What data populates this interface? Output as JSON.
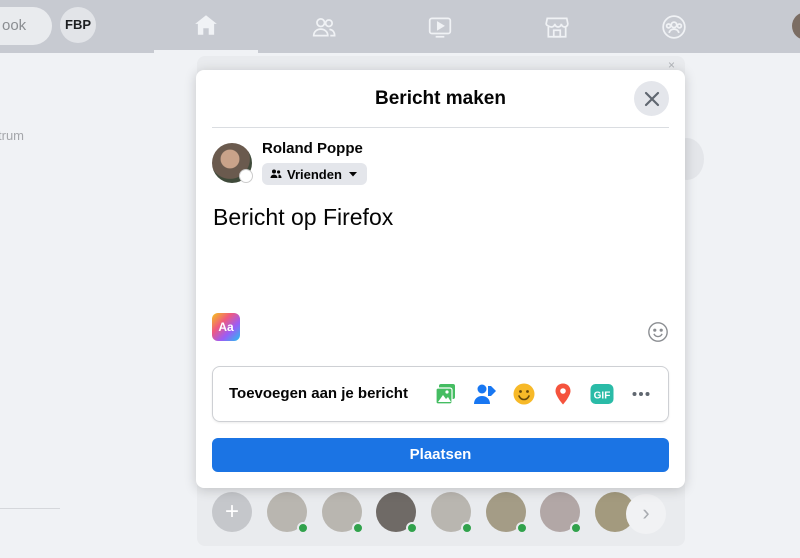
{
  "topbar": {
    "search_placeholder": "ook",
    "shortcut_label": "FBP"
  },
  "background": {
    "left_text": "trum",
    "close_glyph": "×",
    "next_glyph": "›",
    "add_story_glyph": "+"
  },
  "modal": {
    "title": "Bericht maken",
    "author_name": "Roland Poppe",
    "audience_label": "Vrienden",
    "post_text": "Bericht op Firefox",
    "text_format_label": "Aa",
    "add_to_post_label": "Toevoegen aan je bericht",
    "gif_label": "GIF",
    "more_label": "•••",
    "submit_label": "Plaatsen"
  },
  "colors": {
    "primary": "#1b74e4",
    "photo": "#45bd62",
    "tag": "#1877f2",
    "feeling": "#f7b928",
    "location": "#f5533d",
    "gif": "#2abba7"
  },
  "icons": [
    "home-icon",
    "friends-icon",
    "watch-icon",
    "marketplace-icon",
    "groups-icon",
    "close-icon",
    "friends-audience-icon",
    "caret-down-icon",
    "emoji-icon",
    "photo-icon",
    "tag-people-icon",
    "feeling-icon",
    "location-icon",
    "gif-icon",
    "more-icon"
  ]
}
